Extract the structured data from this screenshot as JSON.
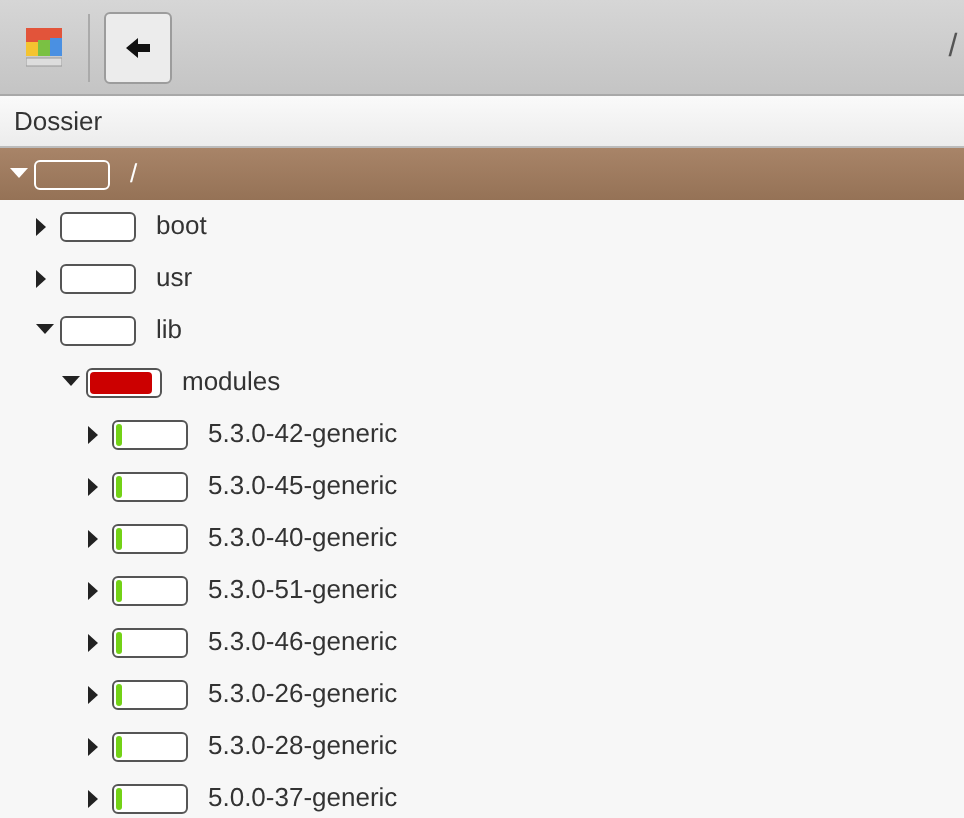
{
  "toolbar": {
    "path": "/"
  },
  "tree": {
    "column": "Dossier",
    "items": [
      {
        "name": "/",
        "selected": true,
        "expanded": true,
        "children": [
          {
            "name": "boot",
            "selected": false,
            "expanded": false
          },
          {
            "name": "usr",
            "selected": false,
            "expanded": false
          },
          {
            "name": "lib",
            "selected": false,
            "expanded": true,
            "children": [
              {
                "name": "modules",
                "selected": false,
                "expanded": true,
                "level": 0.9,
                "color": "#cc0000",
                "children": [
                  {
                    "name": "5.3.0-42-generic",
                    "selected": false,
                    "expanded": false,
                    "level": 0.08,
                    "color": "#73d216"
                  },
                  {
                    "name": "5.3.0-45-generic",
                    "selected": false,
                    "expanded": false,
                    "level": 0.08,
                    "color": "#73d216"
                  },
                  {
                    "name": "5.3.0-40-generic",
                    "selected": false,
                    "expanded": false,
                    "level": 0.08,
                    "color": "#73d216"
                  },
                  {
                    "name": "5.3.0-51-generic",
                    "selected": false,
                    "expanded": false,
                    "level": 0.08,
                    "color": "#73d216"
                  },
                  {
                    "name": "5.3.0-46-generic",
                    "selected": false,
                    "expanded": false,
                    "level": 0.08,
                    "color": "#73d216"
                  },
                  {
                    "name": "5.3.0-26-generic",
                    "selected": false,
                    "expanded": false,
                    "level": 0.08,
                    "color": "#73d216"
                  },
                  {
                    "name": "5.3.0-28-generic",
                    "selected": false,
                    "expanded": false,
                    "level": 0.08,
                    "color": "#73d216"
                  },
                  {
                    "name": "5.0.0-37-generic",
                    "selected": false,
                    "expanded": false,
                    "level": 0.08,
                    "color": "#73d216"
                  }
                ]
              }
            ]
          }
        ]
      }
    ]
  }
}
